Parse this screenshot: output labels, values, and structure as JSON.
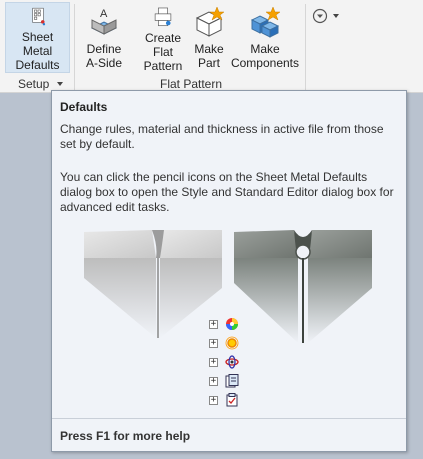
{
  "ribbon": {
    "buttons": {
      "sheet_metal_defaults": {
        "line1": "Sheet Metal",
        "line2": "Defaults"
      },
      "define_a_side": {
        "line1": "Define",
        "line2": "A-Side"
      },
      "create_flat_pattern": {
        "line1": "Create",
        "line2": "Flat Pattern"
      },
      "make_part": {
        "line1": "Make",
        "line2": "Part"
      },
      "make_components": {
        "line1": "Make",
        "line2": "Components"
      }
    },
    "groups": {
      "setup": "Setup",
      "flat_pattern": "Flat Pattern"
    }
  },
  "tooltip": {
    "title": "Defaults",
    "paragraph1": "Change rules, material and thickness in active file from those set by default.",
    "paragraph2": "You can click the pencil icons on the Sheet Metal Defaults dialog box to open the Style and Standard Editor dialog box for advanced edit tasks.",
    "footer": "Press F1 for more help"
  },
  "colors": {
    "ribbon_bg": "#f3f3f3",
    "selected_button_bg": "#d8e6f3",
    "tooltip_bg": "#f0f3f8",
    "app_bg": "#b9c2cf",
    "accent_blue": "#2a7fd4",
    "star_orange": "#f5a000"
  },
  "icons": [
    "sheet-metal-defaults-icon",
    "define-a-side-icon",
    "create-flat-pattern-icon",
    "make-part-icon",
    "make-components-icon",
    "dropdown-arrow-icon",
    "color-wheel-icon",
    "lighting-icon",
    "physical-icon",
    "style-sheet-icon",
    "rule-sheet-icon"
  ]
}
